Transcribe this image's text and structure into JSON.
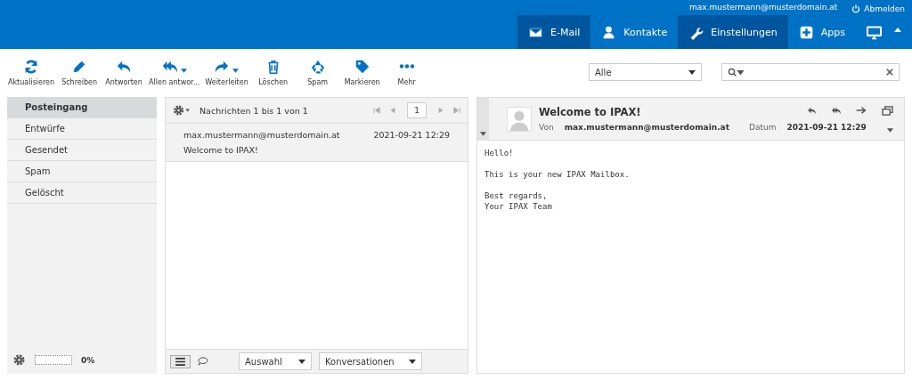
{
  "header": {
    "user": "max.mustermann@musterdomain.at",
    "logout": "Abmelden"
  },
  "nav": [
    {
      "label": "E-Mail",
      "selected": true
    },
    {
      "label": "Kontakte",
      "selected": false
    },
    {
      "label": "Einstellungen",
      "selected": true
    },
    {
      "label": "Apps",
      "selected": false
    }
  ],
  "toolbar": [
    {
      "label": "Aktualisieren",
      "has_menu": false
    },
    {
      "label": "Schreiben",
      "has_menu": false
    },
    {
      "label": "Antworten",
      "has_menu": false
    },
    {
      "label": "Allen antwor...",
      "has_menu": true
    },
    {
      "label": "Weiterleiten",
      "has_menu": true
    },
    {
      "label": "Löschen",
      "has_menu": false
    },
    {
      "label": "Spam",
      "has_menu": false
    },
    {
      "label": "Markieren",
      "has_menu": false
    },
    {
      "label": "Mehr",
      "has_menu": false
    }
  ],
  "filter": {
    "value": "Alle"
  },
  "folders": [
    {
      "label": "Posteingang",
      "selected": true
    },
    {
      "label": "Entwürfe",
      "selected": false
    },
    {
      "label": "Gesendet",
      "selected": false
    },
    {
      "label": "Spam",
      "selected": false
    },
    {
      "label": "Gelöscht",
      "selected": false
    }
  ],
  "quota": {
    "level": 0,
    "reading": "0%"
  },
  "list": {
    "count": "Nachrichten 1 bis 1 von 1",
    "page": "1",
    "messages": [
      {
        "from": "max.mustermann@musterdomain.at",
        "date": "2021-09-21 12:29",
        "subject": "Welcome to IPAX!",
        "selected": true
      }
    ],
    "footer_selects": [
      "Auswahl",
      "Konversationen"
    ]
  },
  "message": {
    "subject": "Welcome to IPAX!",
    "from_label": "Von",
    "from": "max.mustermann@musterdomain.at",
    "date_label": "Datum",
    "date": "2021-09-21 12:29",
    "paragraphs": [
      [
        "Hello!"
      ],
      [
        "This is your new IPAX Mailbox."
      ],
      [
        "Best regards,",
        "Your IPAX Team"
      ]
    ]
  }
}
